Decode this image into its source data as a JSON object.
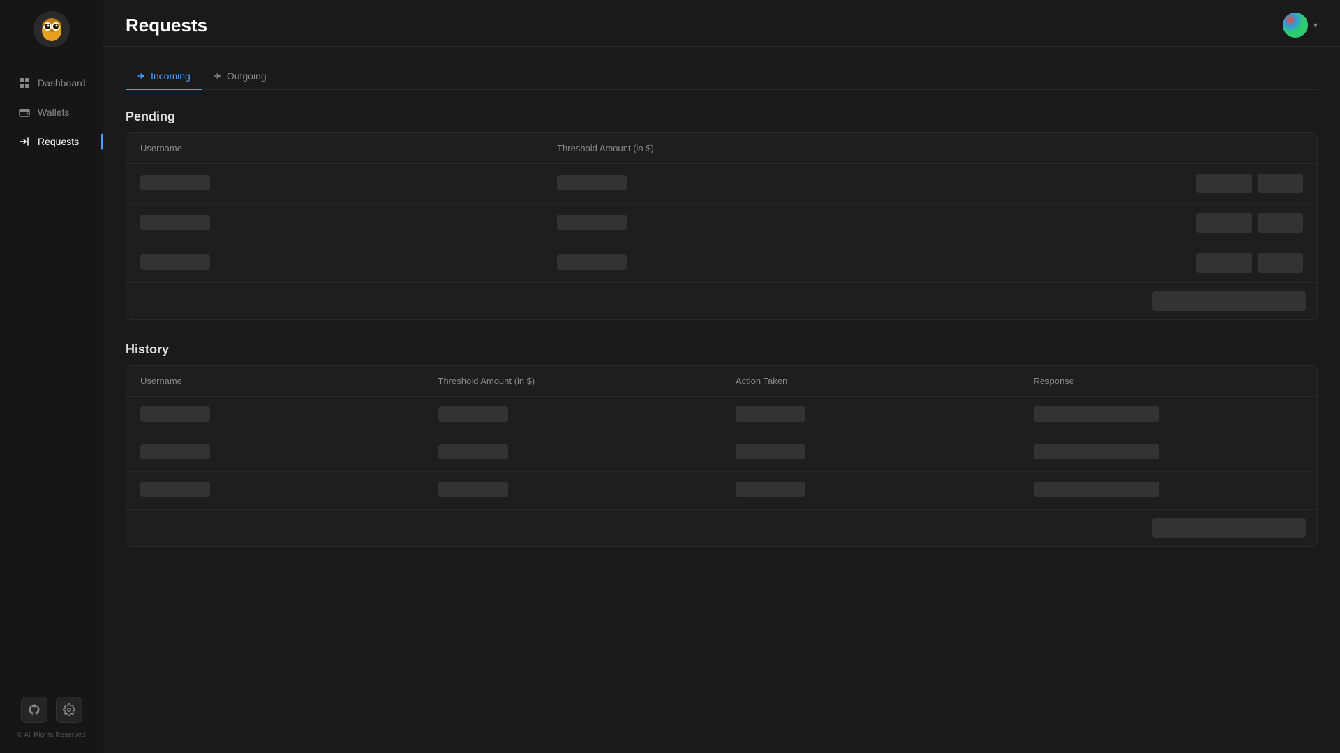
{
  "app": {
    "name": "Hoot",
    "copyright": "© All Rights Reserved"
  },
  "sidebar": {
    "items": [
      {
        "id": "dashboard",
        "label": "Dashboard",
        "active": false
      },
      {
        "id": "wallets",
        "label": "Wallets",
        "active": false
      },
      {
        "id": "requests",
        "label": "Requests",
        "active": true
      }
    ]
  },
  "header": {
    "title": "Requests"
  },
  "tabs": [
    {
      "id": "incoming",
      "label": "Incoming",
      "active": true
    },
    {
      "id": "outgoing",
      "label": "Outgoing",
      "active": false
    }
  ],
  "pending": {
    "heading": "Pending",
    "columns": {
      "username": "Username",
      "threshold": "Threshold Amount (in $)",
      "actions": ""
    },
    "rows": [
      {
        "id": "row1"
      },
      {
        "id": "row2"
      },
      {
        "id": "row3"
      }
    ]
  },
  "history": {
    "heading": "History",
    "columns": {
      "username": "Username",
      "threshold": "Threshold Amount (in $)",
      "action_taken": "Action Taken",
      "response": "Response"
    },
    "rows": [
      {
        "id": "row1"
      },
      {
        "id": "row2"
      },
      {
        "id": "row3"
      }
    ]
  }
}
